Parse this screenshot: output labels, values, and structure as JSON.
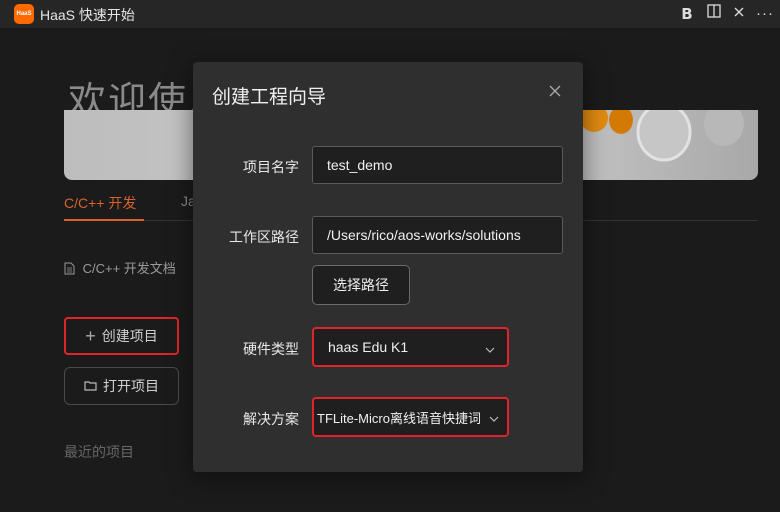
{
  "app": {
    "title": "HaaS 快速开始",
    "logo_text": "HaaS"
  },
  "titlebar_icons": [
    "bold-icon",
    "split-view-icon",
    "close-icon",
    "more-icon"
  ],
  "welcome": {
    "title": "欢迎使用",
    "tabs": [
      {
        "label": "C/C++ 开发",
        "active": true
      },
      {
        "label": "Ja",
        "active": false
      }
    ],
    "doc_link": "C/C++ 开发文档",
    "create_button": "创建项目",
    "open_button": "打开项目",
    "recent_label": "最近的项目"
  },
  "dialog": {
    "title": "创建工程向导",
    "fields": {
      "project_name": {
        "label": "项目名字",
        "value": "test_demo"
      },
      "workspace_path": {
        "label": "工作区路径",
        "value": "/Users/rico/aos-works/solutions"
      },
      "browse_button": "选择路径",
      "hardware_type": {
        "label": "硬件类型",
        "value": "haas Edu K1"
      },
      "solution": {
        "label": "解决方案",
        "value": "TFLite-Micro离线语音快捷词"
      }
    }
  },
  "colors": {
    "accent": "#d9622b",
    "highlight": "#e0242a",
    "brand": "#ff6a00"
  }
}
